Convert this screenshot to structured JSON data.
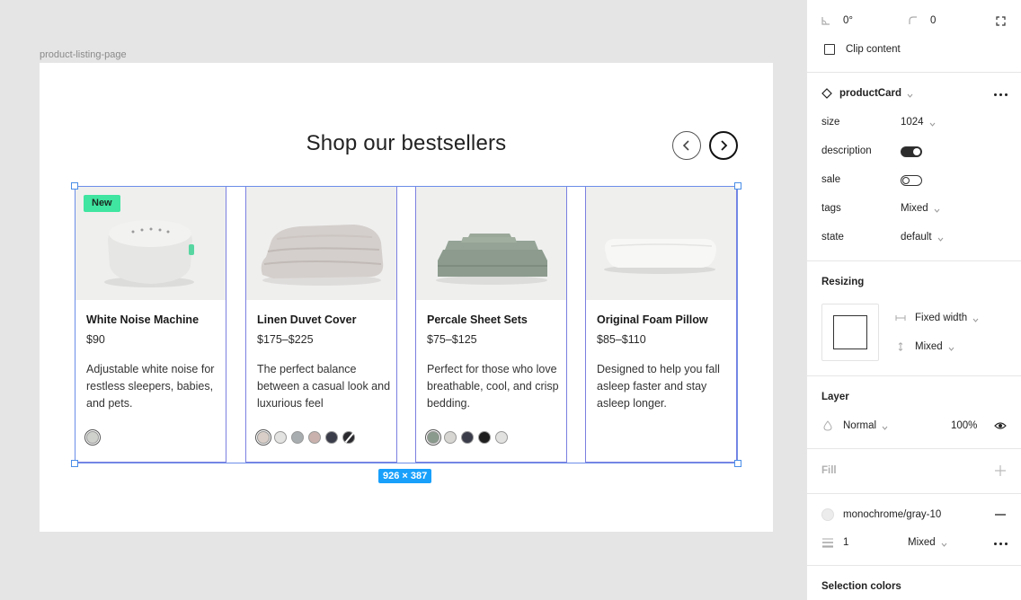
{
  "canvas": {
    "frame_label": "product-listing-page",
    "headline": "Shop our bestsellers",
    "selection_size": "926 × 387",
    "cards": [
      {
        "badge": "New",
        "name": "White Noise Machine",
        "price": "$90",
        "description": "Adjustable white noise for restless sleepers, babies, and pets.",
        "image": "white-noise-machine",
        "swatches": [
          "#cfd1cd"
        ],
        "selected": 0
      },
      {
        "badge": "",
        "name": "Linen Duvet Cover",
        "price": "$175–$225",
        "description": "The perfect balance between a casual look and luxurious feel",
        "image": "duvet",
        "swatches": [
          "#d9cfc8",
          "#e3e3e1",
          "#a8adb0",
          "#c9b2ad",
          "#3a3c4a",
          "#2a2a2e"
        ],
        "selected": 0
      },
      {
        "badge": "",
        "name": "Percale Sheet Sets",
        "price": "$75–$125",
        "description": "Perfect for those who love breathable, cool, and crisp bedding.",
        "image": "sheets",
        "swatches": [
          "#8a9a8c",
          "#d7d6d2",
          "#3a3c4a",
          "#1e1e1e",
          "#e2e2e0"
        ],
        "selected": 0
      },
      {
        "badge": "",
        "name": "Original Foam Pillow",
        "price": "$85–$110",
        "description": "Designed to help you fall asleep faster and stay asleep longer.",
        "image": "pillow",
        "swatches": [],
        "selected": -1
      }
    ]
  },
  "panel": {
    "rotation": "0°",
    "radius": "0",
    "clip_content_label": "Clip content",
    "component": {
      "name": "productCard",
      "props": [
        {
          "label": "size",
          "value": "1024"
        },
        {
          "label": "description",
          "value": ""
        },
        {
          "label": "sale",
          "value": ""
        },
        {
          "label": "tags",
          "value": "Mixed"
        },
        {
          "label": "state",
          "value": "default"
        }
      ]
    },
    "resizing": {
      "title": "Resizing",
      "width_mode": "Fixed width",
      "height_mode": "Mixed"
    },
    "layer": {
      "title": "Layer",
      "blend": "Normal",
      "opacity": "100%"
    },
    "fill": {
      "title": "Fill"
    },
    "stroke": {
      "style_name": "monochrome/gray-10",
      "weight": "1",
      "position": "Mixed"
    },
    "selection_colors": {
      "title": "Selection colors"
    }
  }
}
